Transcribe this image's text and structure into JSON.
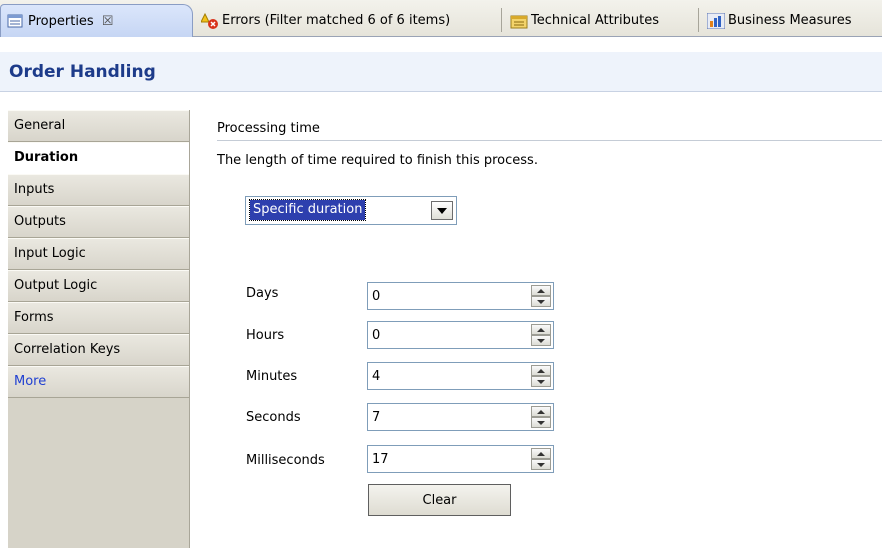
{
  "tabs": [
    {
      "label": "Properties",
      "close": "☒"
    },
    {
      "label": "Errors (Filter matched 6 of 6 items)"
    },
    {
      "label": "Technical Attributes"
    },
    {
      "label": "Business Measures"
    }
  ],
  "header": {
    "title": "Order Handling"
  },
  "sidebar": {
    "items": [
      {
        "label": "General"
      },
      {
        "label": "Duration"
      },
      {
        "label": "Inputs"
      },
      {
        "label": "Outputs"
      },
      {
        "label": "Input Logic"
      },
      {
        "label": "Output Logic"
      },
      {
        "label": "Forms"
      },
      {
        "label": "Correlation Keys"
      },
      {
        "label": "More"
      }
    ],
    "active_label": "Duration"
  },
  "main": {
    "section_title": "Processing time",
    "description": "The length of time required to finish this process.",
    "duration_type": "Specific duration",
    "fields": [
      {
        "label": "Days",
        "value": "0"
      },
      {
        "label": "Hours",
        "value": "0"
      },
      {
        "label": "Minutes",
        "value": "4"
      },
      {
        "label": "Seconds",
        "value": "7"
      },
      {
        "label": "Milliseconds",
        "value": "17"
      }
    ],
    "clear_label": "Clear"
  },
  "colors": {
    "header_title": "#1d3b8a",
    "more_link": "#1f3fd1",
    "selection": "#2d3fae"
  },
  "icons": [
    "properties-icon",
    "errors-icon",
    "technical-attributes-icon",
    "business-measures-icon"
  ]
}
